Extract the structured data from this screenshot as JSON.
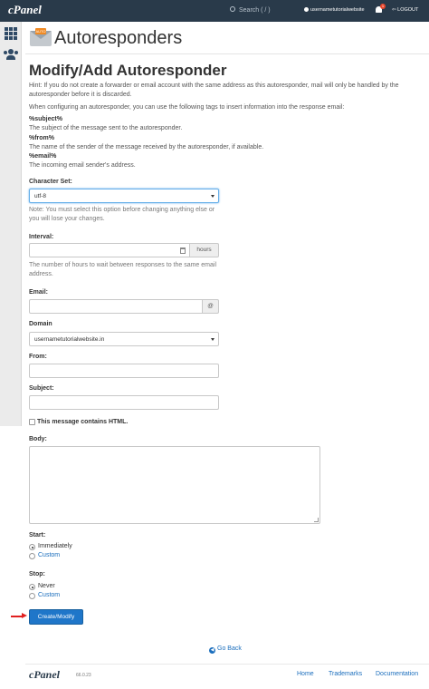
{
  "topbar": {
    "logo": "cPanel",
    "search_placeholder": "Search ( / )",
    "username": "usernametutorialwebsite",
    "notification_count": "1",
    "logout": "LOGOUT"
  },
  "header": {
    "icon_tag": "AUTO",
    "title": "Autoresponders"
  },
  "form": {
    "section_title": "Modify/Add Autoresponder",
    "hint": "Hint: If you do not create a forwarder or email account with the same address as this autoresponder, mail will only be handled by the autoresponder before it is discarded.",
    "tags_intro": "When configuring an autoresponder, you can use the following tags to insert information into the response email:",
    "tags": [
      {
        "name": "%subject%",
        "desc": "The subject of the message sent to the autoresponder."
      },
      {
        "name": "%from%",
        "desc": "The name of the sender of the message received by the autoresponder, if available."
      },
      {
        "name": "%email%",
        "desc": "The incoming email sender's address."
      }
    ],
    "charset_label": "Character Set:",
    "charset_value": "utf-8",
    "charset_note": "Note: You must select this option before changing anything else or you will lose your changes.",
    "interval_label": "Interval:",
    "interval_unit": "hours",
    "interval_help": "The number of hours to wait between responses to the same email address.",
    "email_label": "Email:",
    "email_addon": "@",
    "domain_label": "Domain",
    "domain_value": "usernametutorialwebsite.in",
    "from_label": "From:",
    "subject_label": "Subject:",
    "html_label": "This message contains HTML.",
    "body_label": "Body:",
    "start_label": "Start:",
    "start_options": [
      "Immediately",
      "Custom"
    ],
    "stop_label": "Stop:",
    "stop_options": [
      "Never",
      "Custom"
    ],
    "submit_label": "Create/Modify",
    "goback_label": "Go Back"
  },
  "footer": {
    "logo": "cPanel",
    "version": "66.0.23",
    "links": [
      "Home",
      "Trademarks",
      "Documentation"
    ]
  },
  "colors": {
    "topbar": "#293a4a",
    "primary_button": "#1f76c9",
    "link": "#1b6ebd",
    "arrow": "#e02020",
    "icon_tag": "#f08a24"
  }
}
